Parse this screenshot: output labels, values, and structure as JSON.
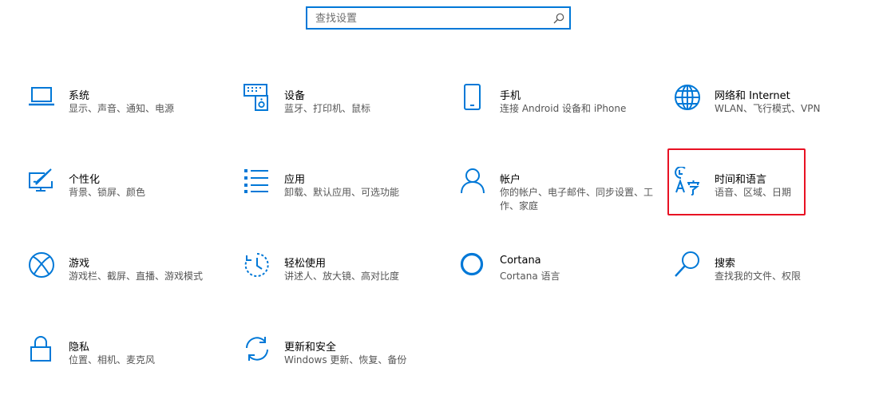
{
  "search": {
    "placeholder": "查找设置",
    "value": ""
  },
  "tiles": [
    {
      "key": "system",
      "title": "系统",
      "desc": "显示、声音、通知、电源",
      "icon": "laptop-icon"
    },
    {
      "key": "devices",
      "title": "设备",
      "desc": "蓝牙、打印机、鼠标",
      "icon": "keyboard-speaker-icon"
    },
    {
      "key": "phone",
      "title": "手机",
      "desc": "连接 Android 设备和 iPhone",
      "icon": "phone-icon"
    },
    {
      "key": "network",
      "title": "网络和 Internet",
      "desc": "WLAN、飞行模式、VPN",
      "icon": "globe-icon"
    },
    {
      "key": "personalization",
      "title": "个性化",
      "desc": "背景、锁屏、颜色",
      "icon": "paint-screen-icon"
    },
    {
      "key": "apps",
      "title": "应用",
      "desc": "卸载、默认应用、可选功能",
      "icon": "apps-list-icon"
    },
    {
      "key": "accounts",
      "title": "帐户",
      "desc": "你的帐户、电子邮件、同步设置、工作、家庭",
      "icon": "person-icon"
    },
    {
      "key": "time-language",
      "title": "时间和语言",
      "desc": "语音、区域、日期",
      "icon": "clock-language-icon"
    },
    {
      "key": "gaming",
      "title": "游戏",
      "desc": "游戏栏、截屏、直播、游戏模式",
      "icon": "xbox-icon"
    },
    {
      "key": "ease-of-access",
      "title": "轻松使用",
      "desc": "讲述人、放大镜、高对比度",
      "icon": "ease-of-access-icon"
    },
    {
      "key": "cortana",
      "title": "Cortana",
      "desc": "Cortana 语言",
      "icon": "cortana-icon"
    },
    {
      "key": "search",
      "title": "搜索",
      "desc": "查找我的文件、权限",
      "icon": "magnifier-icon"
    },
    {
      "key": "privacy",
      "title": "隐私",
      "desc": "位置、相机、麦克风",
      "icon": "lock-icon"
    },
    {
      "key": "update-security",
      "title": "更新和安全",
      "desc": "Windows 更新、恢复、备份",
      "icon": "sync-arrows-icon"
    }
  ],
  "colors": {
    "accent": "#0078d7",
    "highlight": "#e81123",
    "desc_text": "#555555"
  }
}
